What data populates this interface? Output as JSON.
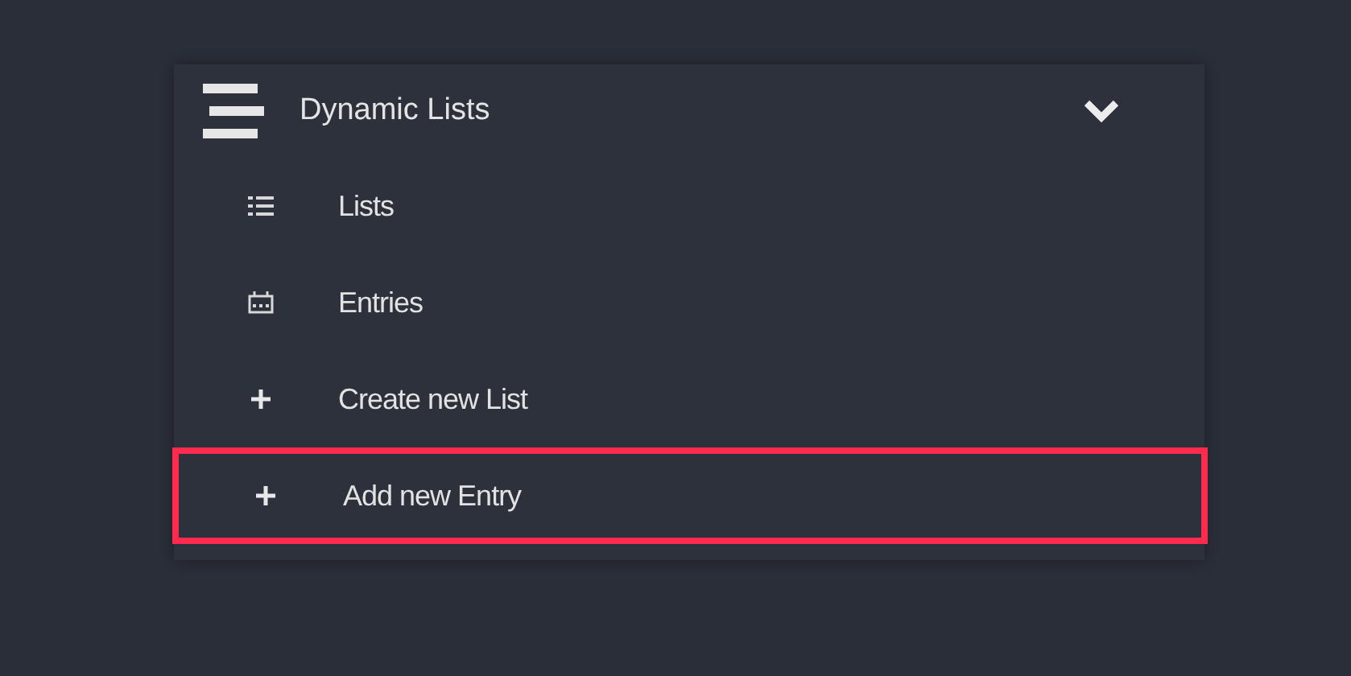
{
  "menu": {
    "title": "Dynamic Lists",
    "expanded": true,
    "items": [
      {
        "label": "Lists",
        "kind": "list",
        "highlighted": false
      },
      {
        "label": "Entries",
        "kind": "calendar",
        "highlighted": false
      },
      {
        "label": "Create new List",
        "kind": "plus",
        "highlighted": false
      },
      {
        "label": "Add new Entry",
        "kind": "plus",
        "highlighted": true
      }
    ]
  }
}
